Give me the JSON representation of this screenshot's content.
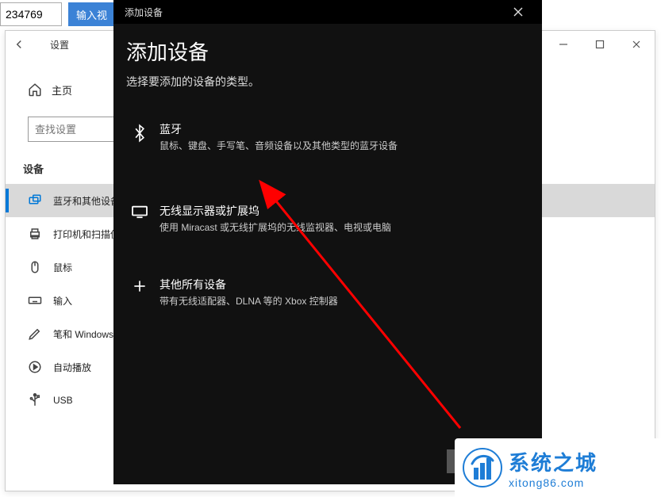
{
  "topbar": {
    "input_value": "234769",
    "button_label": "输入视"
  },
  "settings": {
    "title": "设置",
    "home_label": "主页",
    "search_placeholder": "查找设置",
    "section_header": "设备",
    "nav": [
      {
        "label": "蓝牙和其他设备",
        "icon": "bluetooth-devices-icon",
        "active": true
      },
      {
        "label": "打印机和扫描仪",
        "icon": "printer-icon",
        "active": false
      },
      {
        "label": "鼠标",
        "icon": "mouse-icon",
        "active": false
      },
      {
        "label": "输入",
        "icon": "keyboard-icon",
        "active": false
      },
      {
        "label": "笔和 Windows",
        "icon": "pen-icon",
        "active": false
      },
      {
        "label": "自动播放",
        "icon": "autoplay-icon",
        "active": false
      },
      {
        "label": "USB",
        "icon": "usb-icon",
        "active": false
      }
    ]
  },
  "dialog": {
    "titlebar": "添加设备",
    "heading": "添加设备",
    "subtitle": "选择要添加的设备的类型。",
    "options": [
      {
        "title": "蓝牙",
        "desc": "鼠标、键盘、手写笔、音频设备以及其他类型的蓝牙设备",
        "icon": "bluetooth-icon"
      },
      {
        "title": "无线显示器或扩展坞",
        "desc": "使用 Miracast 或无线扩展坞的无线监视器、电视或电脑",
        "icon": "display-icon"
      },
      {
        "title": "其他所有设备",
        "desc": "带有无线适配器、DLNA 等的 Xbox 控制器",
        "icon": "plus-icon"
      }
    ]
  },
  "watermark": {
    "cn": "系统之城",
    "en": "xitong86.com"
  }
}
